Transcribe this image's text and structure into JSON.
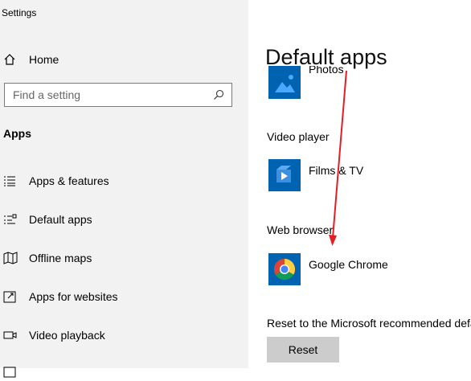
{
  "window": {
    "title": "Settings"
  },
  "sidebar": {
    "home_label": "Home",
    "search_placeholder": "Find a setting",
    "section_title": "Apps",
    "items": [
      {
        "label": "Apps & features",
        "icon": "list-icon"
      },
      {
        "label": "Default apps",
        "icon": "default-apps-icon"
      },
      {
        "label": "Offline maps",
        "icon": "map-icon"
      },
      {
        "label": "Apps for websites",
        "icon": "open-link-icon"
      },
      {
        "label": "Video playback",
        "icon": "video-icon"
      }
    ]
  },
  "main": {
    "title": "Default apps",
    "photos_app": "Photos",
    "video_player_label": "Video player",
    "video_player_app": "Films & TV",
    "web_browser_label": "Web browser",
    "web_browser_app": "Google Chrome",
    "reset_text": "Reset to the Microsoft recommended defaults",
    "reset_button": "Reset"
  },
  "colors": {
    "sidebar_bg": "#f2f2f2",
    "tile_blue": "#0063b1",
    "annotation_arrow": "#e31e24",
    "button_bg": "#cccccc"
  }
}
